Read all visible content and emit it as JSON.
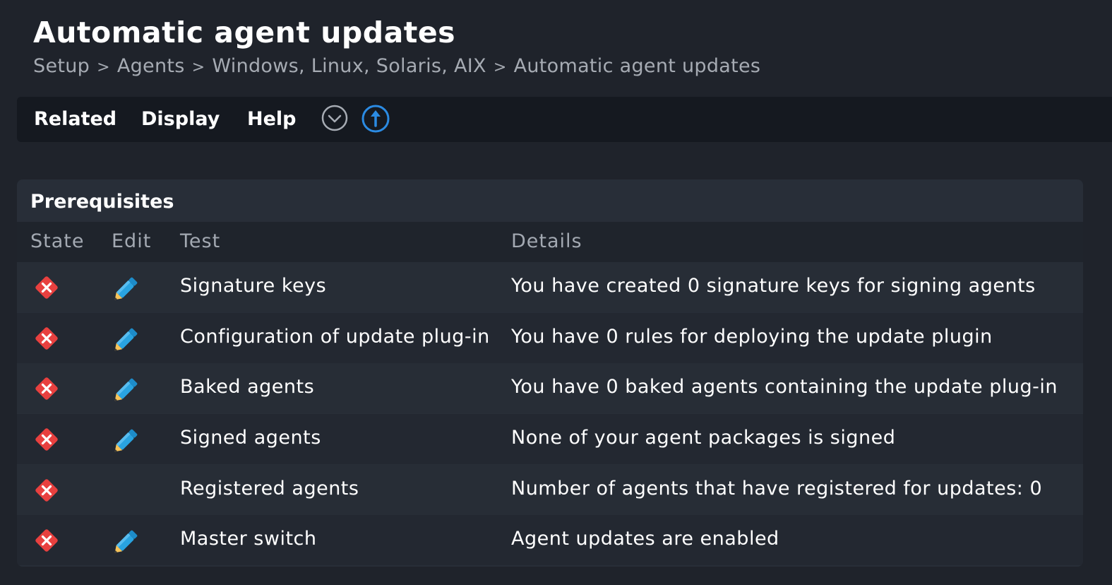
{
  "page": {
    "title": "Automatic agent updates",
    "breadcrumb": [
      "Setup",
      "Agents",
      "Windows, Linux, Solaris, AIX",
      "Automatic agent updates"
    ],
    "breadcrumb_separator": ">"
  },
  "menubar": {
    "related": "Related",
    "display": "Display",
    "help": "Help",
    "icons": [
      "chevron-down-circle-icon",
      "upload-arrow-circle-icon"
    ]
  },
  "prerequisites": {
    "title": "Prerequisites",
    "columns": {
      "state": "State",
      "edit": "Edit",
      "test": "Test",
      "details": "Details"
    },
    "rows": [
      {
        "state": "error",
        "editable": true,
        "test": "Signature keys",
        "details": "You have created 0 signature keys for signing agents"
      },
      {
        "state": "error",
        "editable": true,
        "test": "Configuration of update plug-in",
        "details": "You have 0 rules for deploying the update plugin"
      },
      {
        "state": "error",
        "editable": true,
        "test": "Baked agents",
        "details": "You have 0 baked agents containing the update plug-in"
      },
      {
        "state": "error",
        "editable": true,
        "test": "Signed agents",
        "details": "None of your agent packages is signed"
      },
      {
        "state": "error",
        "editable": false,
        "test": "Registered agents",
        "details": "Number of agents that have registered for updates: 0"
      },
      {
        "state": "error",
        "editable": true,
        "test": "Master switch",
        "details": "Agent updates are enabled"
      }
    ]
  },
  "colors": {
    "error": "#e8403f",
    "pencil_blue": "#29a3e0",
    "accent_blue": "#2b8be3"
  }
}
